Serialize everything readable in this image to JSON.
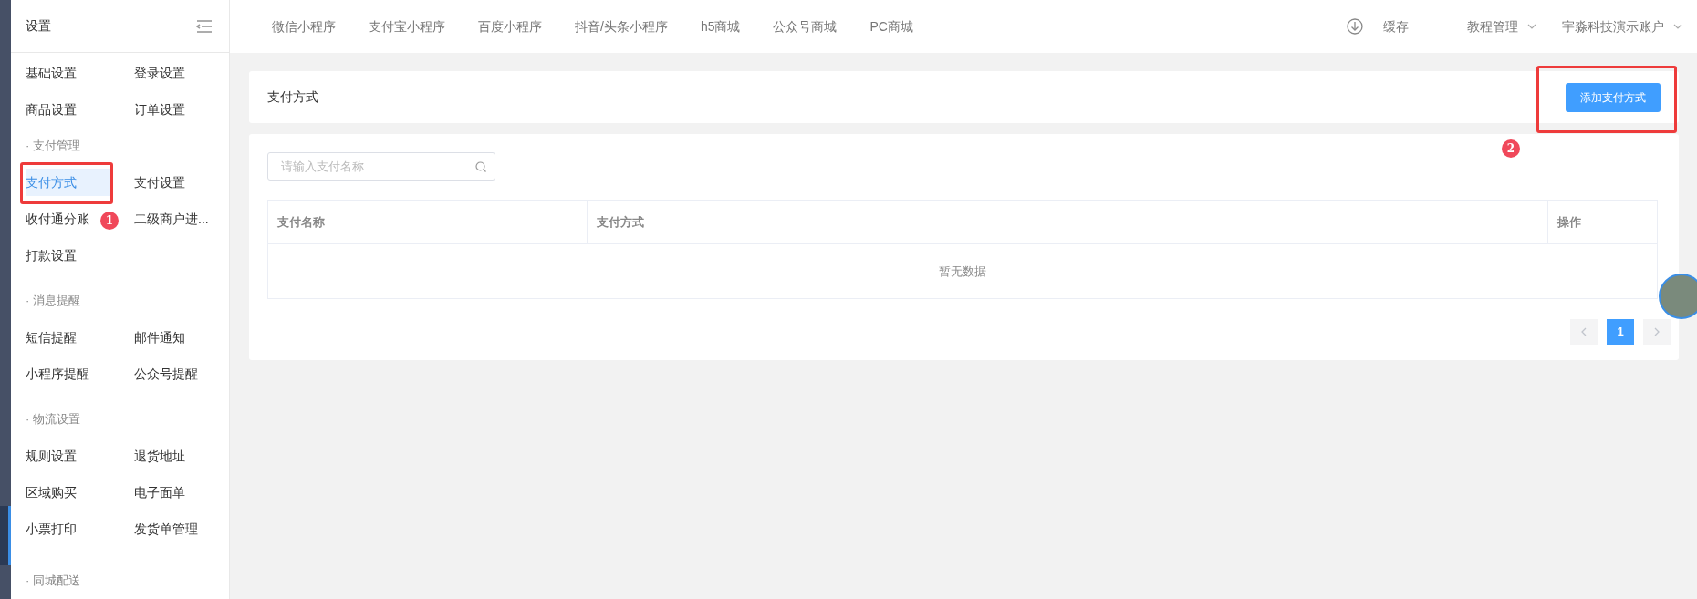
{
  "sidebar": {
    "title": "设置",
    "sections": [
      {
        "items": [
          {
            "label": "基础设置",
            "selected": false
          },
          {
            "label": "登录设置",
            "selected": false
          },
          {
            "label": "商品设置",
            "selected": false
          },
          {
            "label": "订单设置",
            "selected": false
          }
        ]
      },
      {
        "title": "· 支付管理",
        "items": [
          {
            "label": "支付方式",
            "selected": true,
            "annotation": {
              "label": "1"
            }
          },
          {
            "label": "支付设置",
            "selected": false
          },
          {
            "label": "收付通分账",
            "selected": false
          },
          {
            "label": "二级商户进...",
            "selected": false
          },
          {
            "label": "打款设置",
            "selected": false
          }
        ]
      },
      {
        "title": "· 消息提醒",
        "items": [
          {
            "label": "短信提醒",
            "selected": false
          },
          {
            "label": "邮件通知",
            "selected": false
          },
          {
            "label": "小程序提醒",
            "selected": false
          },
          {
            "label": "公众号提醒",
            "selected": false
          }
        ]
      },
      {
        "title": "· 物流设置",
        "items": [
          {
            "label": "规则设置",
            "selected": false
          },
          {
            "label": "退货地址",
            "selected": false
          },
          {
            "label": "区域购买",
            "selected": false
          },
          {
            "label": "电子面单",
            "selected": false
          },
          {
            "label": "小票打印",
            "selected": false
          },
          {
            "label": "发货单管理",
            "selected": false
          }
        ]
      },
      {
        "title": "· 同城配送"
      }
    ]
  },
  "top_nav": {
    "links": [
      "微信小程序",
      "支付宝小程序",
      "百度小程序",
      "抖音/头条小程序",
      "h5商城",
      "公众号商城",
      "PC商城"
    ],
    "cache": "缓存",
    "menus": [
      "教程管理",
      "宇淼科技演示账户"
    ]
  },
  "page": {
    "title": "支付方式",
    "add_button": {
      "label": "添加支付方式",
      "annotation": {
        "label": "2"
      }
    },
    "search": {
      "placeholder": "请输入支付名称"
    },
    "table": {
      "columns": [
        "支付名称",
        "支付方式",
        "操作"
      ],
      "empty_text": "暂无数据"
    },
    "pagination": {
      "pages": [
        {
          "label": "1",
          "selected": true
        }
      ]
    }
  }
}
